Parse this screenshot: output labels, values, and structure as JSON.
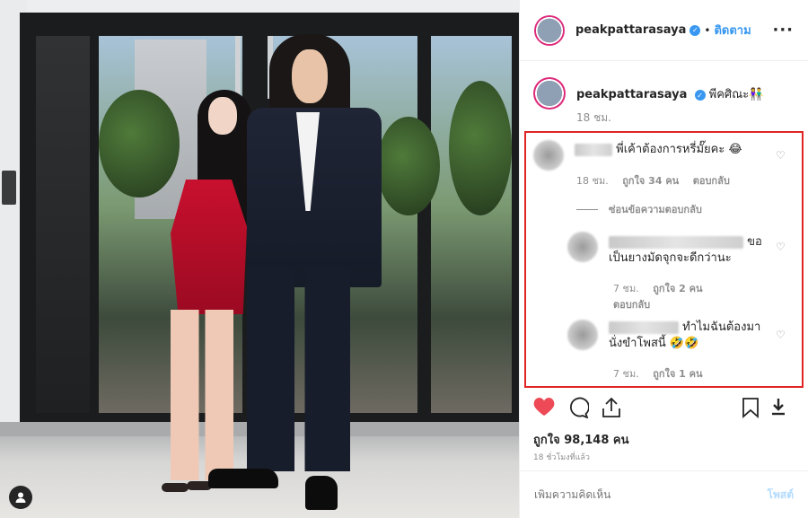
{
  "post_header": {
    "username": "peakpattarasaya",
    "dot": "•",
    "follow_label": "ติดตาม",
    "more_label": "···"
  },
  "caption": {
    "username": "peakpattarasaya",
    "text": "พีคศิณะ👫",
    "time": "18 ชม."
  },
  "comments": [
    {
      "text": "พี่เค้าต้องการหรี่มั๊ยคะ 😂",
      "time": "18 ชม.",
      "likes": "ถูกใจ 34 คน",
      "reply": "ตอบกลับ"
    }
  ],
  "hide_replies": "ซ่อนข้อความตอบกลับ",
  "replies": [
    {
      "text_suffix": "ขอ",
      "text_line2": "เป็นยางมัดจุกจะดีกว่านะ",
      "time": "7 ชม.",
      "likes": "ถูกใจ 2 คน",
      "reply": "ตอบกลับ"
    },
    {
      "text_suffix": "ทำไมฉันต้องมา",
      "text_line2": "นั่งขำโพสนี้ 🤣🤣",
      "time": "7 ชม.",
      "likes": "ถูกใจ 1 คน"
    }
  ],
  "likes_total": "ถูกใจ 98,148 คน",
  "posted_ago": "18 ชั่วโมงที่แล้ว",
  "add_comment_placeholder": "เพิ่มความคิดเห็น",
  "post_label": "โพสต์",
  "colors": {
    "accent": "#3897f0",
    "heart": "#ed4956",
    "highlight_box": "#e02424"
  },
  "icons": [
    "heart-icon",
    "comment-icon",
    "share-icon",
    "bookmark-icon",
    "download-icon",
    "user-tag-icon"
  ]
}
